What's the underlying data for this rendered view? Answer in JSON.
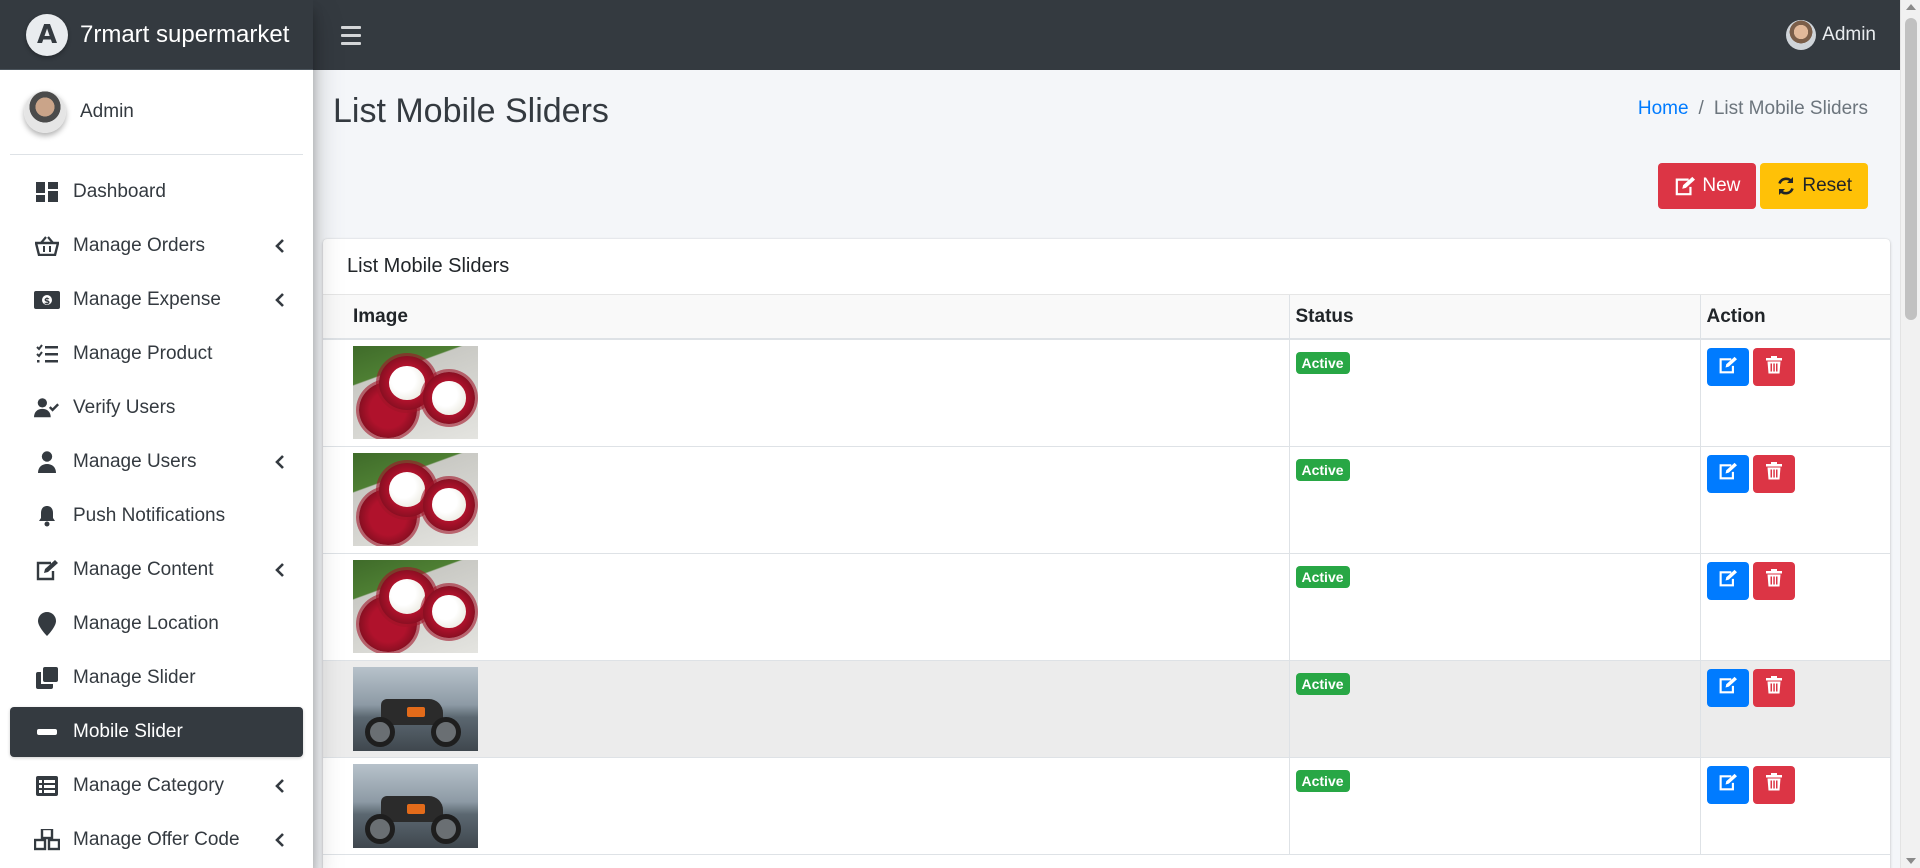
{
  "brand": {
    "name": "7rmart supermarket"
  },
  "sidebar": {
    "user_name": "Admin",
    "items": [
      {
        "label": "Dashboard",
        "icon": "dashboard-icon",
        "has_children": false,
        "active": false
      },
      {
        "label": "Manage Orders",
        "icon": "basket-icon",
        "has_children": true,
        "active": false
      },
      {
        "label": "Manage Expense",
        "icon": "money-icon",
        "has_children": true,
        "active": false
      },
      {
        "label": "Manage Product",
        "icon": "tasks-icon",
        "has_children": false,
        "active": false
      },
      {
        "label": "Verify Users",
        "icon": "user-check-icon",
        "has_children": false,
        "active": false
      },
      {
        "label": "Manage Users",
        "icon": "user-icon",
        "has_children": true,
        "active": false
      },
      {
        "label": "Push Notifications",
        "icon": "bell-icon",
        "has_children": false,
        "active": false
      },
      {
        "label": "Manage Content",
        "icon": "edit-icon",
        "has_children": true,
        "active": false
      },
      {
        "label": "Manage Location",
        "icon": "map-marker-icon",
        "has_children": false,
        "active": false
      },
      {
        "label": "Manage Slider",
        "icon": "clone-icon",
        "has_children": false,
        "active": false
      },
      {
        "label": "Mobile Slider",
        "icon": "minus-icon",
        "has_children": false,
        "active": true
      },
      {
        "label": "Manage Category",
        "icon": "list-icon",
        "has_children": true,
        "active": false
      },
      {
        "label": "Manage Offer Code",
        "icon": "cubes-icon",
        "has_children": true,
        "active": false
      }
    ]
  },
  "topbar": {
    "user_name": "Admin"
  },
  "page": {
    "title": "List Mobile Sliders",
    "breadcrumb": {
      "home": "Home",
      "separator": "/",
      "current": "List Mobile Sliders"
    },
    "buttons": {
      "new": "New",
      "reset": "Reset"
    }
  },
  "card": {
    "title": "List Mobile Sliders",
    "columns": [
      "Image",
      "Status",
      "Action"
    ],
    "rows": [
      {
        "image": "rambutan",
        "status": "Active"
      },
      {
        "image": "rambutan",
        "status": "Active"
      },
      {
        "image": "rambutan",
        "status": "Active"
      },
      {
        "image": "motorcycle",
        "status": "Active"
      },
      {
        "image": "motorcycle",
        "status": "Active"
      }
    ]
  },
  "colors": {
    "sidebar_active": "#343a40",
    "topbar": "#343a40",
    "danger": "#dc3545",
    "warning": "#ffc107",
    "primary": "#007bff",
    "success": "#28a745"
  }
}
